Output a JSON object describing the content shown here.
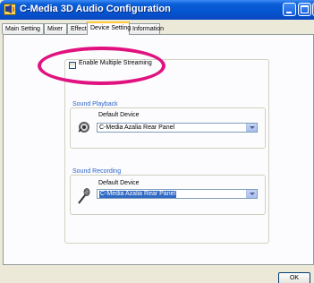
{
  "window": {
    "title": "C-Media 3D Audio Configuration",
    "icon": "speaker-app-icon"
  },
  "tabs": [
    {
      "label": "Main Setting",
      "active": false
    },
    {
      "label": "Mixer",
      "active": false
    },
    {
      "label": "Effect",
      "active": false
    },
    {
      "label": "Device Setting",
      "active": true
    },
    {
      "label": "Information",
      "active": false
    }
  ],
  "device_setting": {
    "multiple_streaming": {
      "label": "Enable Multiple Streaming",
      "checked": false
    },
    "sound_playback": {
      "title": "Sound Playback",
      "device_label": "Default Device",
      "device_value": "C-Media Azalia Rear Panel",
      "icon": "speaker-icon"
    },
    "sound_recording": {
      "title": "Sound Recording",
      "device_label": "Default Device",
      "device_value": "C-Media Azalia Rear Panel",
      "icon": "microphone-icon"
    }
  },
  "buttons": {
    "ok": "OK"
  },
  "colors": {
    "highlight": "#e0127f",
    "group_title": "#2a64c8",
    "titlebar": "#0454d0",
    "selection": "#316ac5"
  }
}
